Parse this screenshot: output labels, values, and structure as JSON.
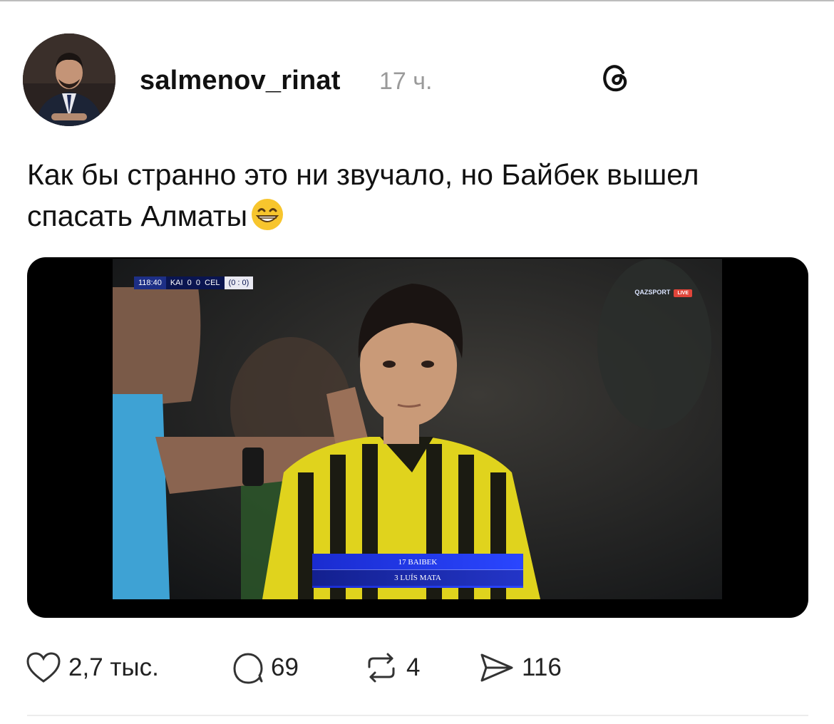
{
  "post": {
    "username": "salmenov_rinat",
    "time": "17 ч.",
    "text": "Как бы странно это ни звучало, но Байбек вышел спасать Алматы"
  },
  "media": {
    "scorebug": {
      "clock": "118:40",
      "teams": "KAI  0  0  CEL",
      "aggregate": "(0 : 0)"
    },
    "broadcaster": "QAZSPORT",
    "live_badge": "LIVE",
    "substitution": {
      "in": "17 BAIBEK",
      "out": "3 LUÍS MATA"
    }
  },
  "actions": {
    "likes": "2,7 тыс.",
    "replies": "69",
    "reposts": "4",
    "shares": "116"
  },
  "colors": {
    "text": "#111111",
    "muted": "#9a9a9a",
    "banner": "#2a46ff"
  }
}
